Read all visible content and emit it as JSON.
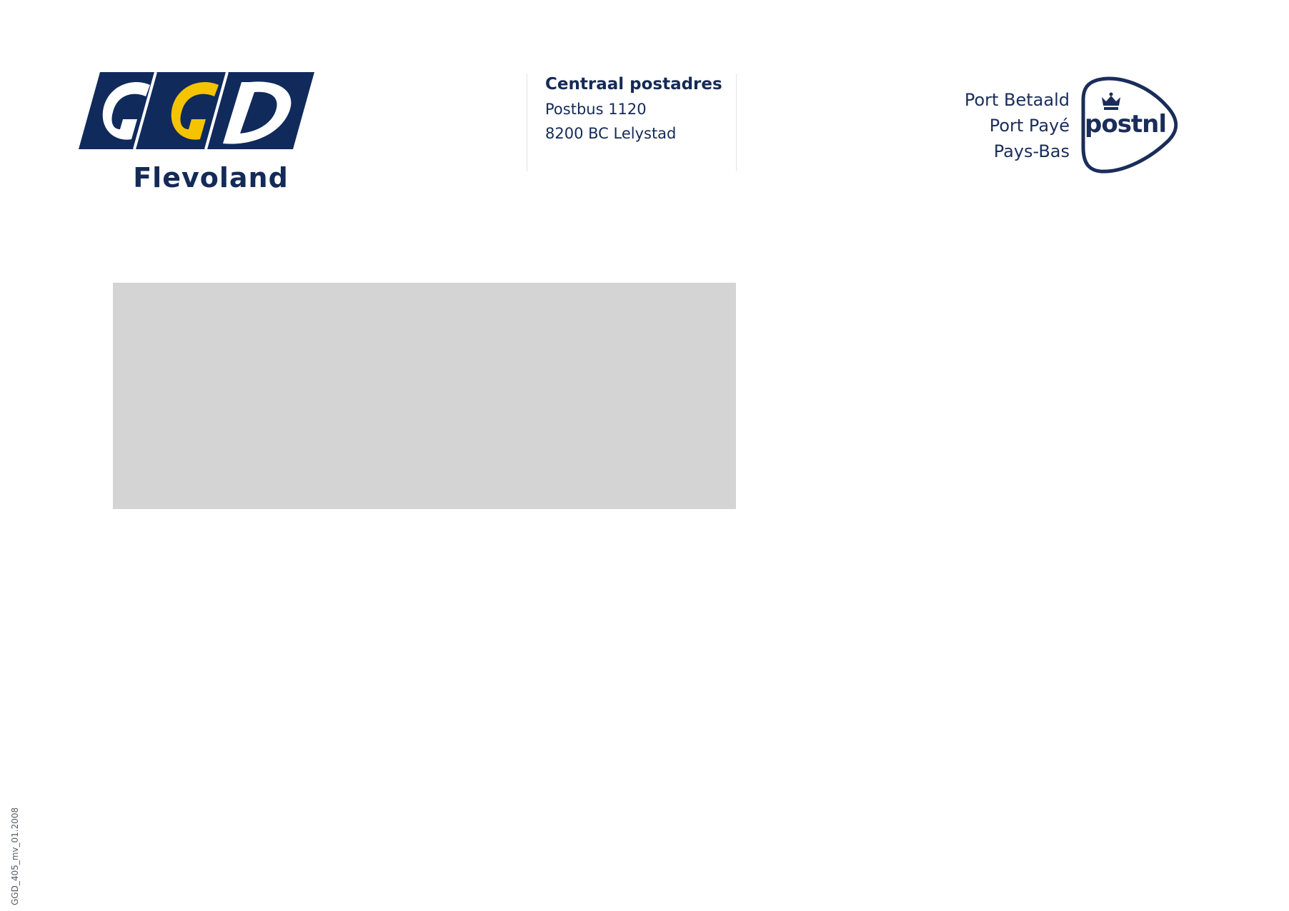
{
  "sender": {
    "logo_text": "GGD",
    "region": "Flevoland",
    "brand_colors": {
      "navy": "#102a5c",
      "yellow": "#f5c400",
      "white": "#ffffff"
    }
  },
  "central_address": {
    "title": "Centraal postadres",
    "line1": "Postbus 1120",
    "line2": "8200 BC Lelystad"
  },
  "postage": {
    "line1": "Port Betaald",
    "line2": "Port Payé",
    "line3": "Pays-Bas",
    "brand": "postnl",
    "icon": "crown-icon"
  },
  "address_window": {
    "color": "#d4d4d4"
  },
  "document_code": "GGD_405_mv_01.2008"
}
